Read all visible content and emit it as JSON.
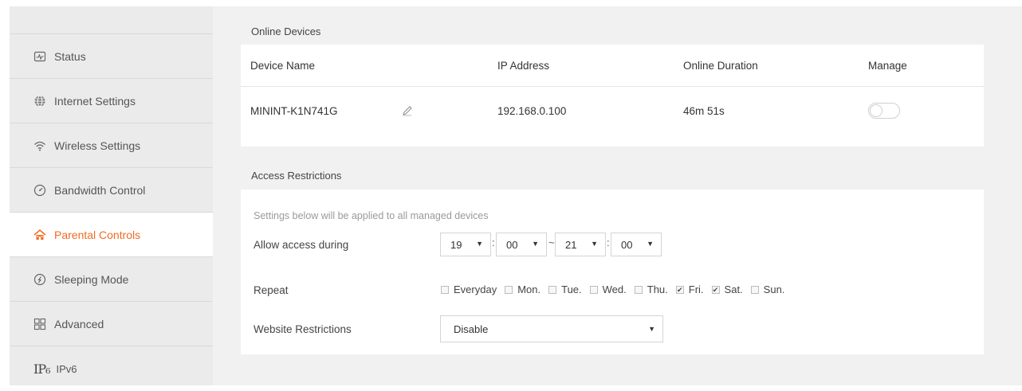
{
  "sidebar": {
    "items": [
      {
        "label": "Status",
        "icon": "status-icon",
        "active": false
      },
      {
        "label": "Internet Settings",
        "icon": "globe-icon",
        "active": false
      },
      {
        "label": "Wireless Settings",
        "icon": "wifi-icon",
        "active": false
      },
      {
        "label": "Bandwidth Control",
        "icon": "gauge-icon",
        "active": false
      },
      {
        "label": "Parental Controls",
        "icon": "house-icon",
        "active": true
      },
      {
        "label": "Sleeping Mode",
        "icon": "sleep-icon",
        "active": false
      },
      {
        "label": "Advanced",
        "icon": "grid-icon",
        "active": false
      },
      {
        "label": "IPv6",
        "icon_text": "IP₆",
        "active": false
      }
    ],
    "accent_color": "#f26b21"
  },
  "online_devices": {
    "title": "Online Devices",
    "columns": [
      "Device Name",
      "IP Address",
      "Online Duration",
      "Manage"
    ],
    "rows": [
      {
        "device_name": "MININT-K1N741G",
        "ip": "192.168.0.100",
        "duration": "46m 51s",
        "manage_on": false
      }
    ]
  },
  "access_restrictions": {
    "title": "Access Restrictions",
    "hint": "Settings below will be applied to all managed devices",
    "allow_label": "Allow access during",
    "start_hour": "19",
    "start_min": "00",
    "end_hour": "21",
    "end_min": "00",
    "repeat_label": "Repeat",
    "days": [
      {
        "label": "Everyday",
        "checked": false
      },
      {
        "label": "Mon.",
        "checked": false
      },
      {
        "label": "Tue.",
        "checked": false
      },
      {
        "label": "Wed.",
        "checked": false
      },
      {
        "label": "Thu.",
        "checked": false
      },
      {
        "label": "Fri.",
        "checked": true
      },
      {
        "label": "Sat.",
        "checked": true
      },
      {
        "label": "Sun.",
        "checked": false
      }
    ],
    "website_label": "Website Restrictions",
    "website_value": "Disable"
  }
}
